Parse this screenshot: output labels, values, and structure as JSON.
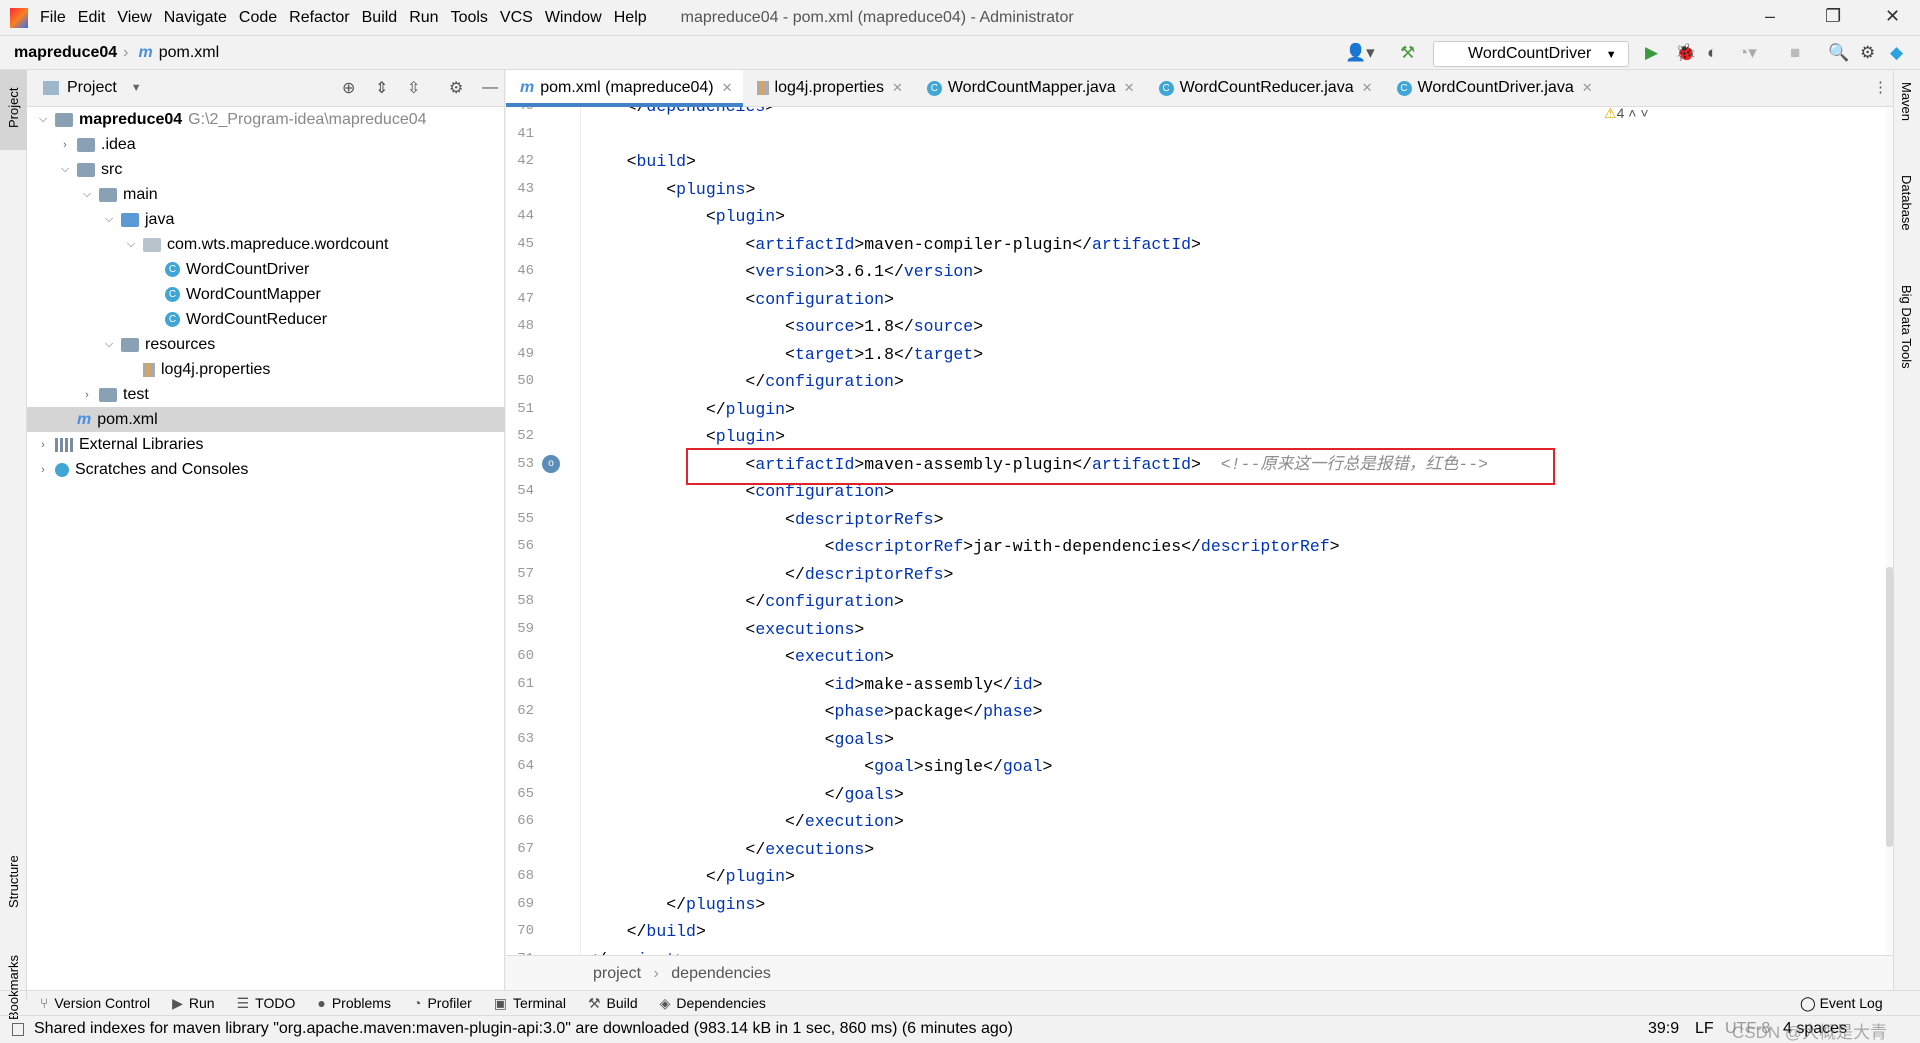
{
  "menu": [
    "File",
    "Edit",
    "View",
    "Navigate",
    "Code",
    "Refactor",
    "Build",
    "Run",
    "Tools",
    "VCS",
    "Window",
    "Help"
  ],
  "window_title": "mapreduce04 - pom.xml (mapreduce04) - Administrator",
  "nav": {
    "project": "mapreduce04",
    "file": "pom.xml",
    "run_config": "WordCountDriver"
  },
  "left_stripe": {
    "project": "Project",
    "structure": "Structure",
    "bookmarks": "Bookmarks"
  },
  "right_stripe": {
    "maven": "Maven",
    "database": "Database",
    "bigdata": "Big Data Tools"
  },
  "project_panel": {
    "title": "Project",
    "tree": [
      {
        "label": "mapreduce04",
        "extra": "G:\\2_Program-idea\\mapreduce04",
        "level": 0,
        "arrow": "v",
        "icon": "folder",
        "bold": true
      },
      {
        "label": ".idea",
        "level": 1,
        "arrow": ">",
        "icon": "folder"
      },
      {
        "label": "src",
        "level": 1,
        "arrow": "v",
        "icon": "folder"
      },
      {
        "label": "main",
        "level": 2,
        "arrow": "v",
        "icon": "folder"
      },
      {
        "label": "java",
        "level": 3,
        "arrow": "v",
        "icon": "folder"
      },
      {
        "label": "com.wts.mapreduce.wordcount",
        "level": 4,
        "arrow": "v",
        "icon": "package"
      },
      {
        "label": "WordCountDriver",
        "level": 5,
        "icon": "class"
      },
      {
        "label": "WordCountMapper",
        "level": 5,
        "icon": "class"
      },
      {
        "label": "WordCountReducer",
        "level": 5,
        "icon": "class"
      },
      {
        "label": "resources",
        "level": 3,
        "arrow": "v",
        "icon": "folder"
      },
      {
        "label": "log4j.properties",
        "level": 4,
        "icon": "properties"
      },
      {
        "label": "test",
        "level": 2,
        "arrow": ">",
        "icon": "folder"
      },
      {
        "label": "pom.xml",
        "level": 1,
        "icon": "maven",
        "selected": true
      },
      {
        "label": "External Libraries",
        "level": 0,
        "arrow": ">",
        "icon": "library"
      },
      {
        "label": "Scratches and Consoles",
        "level": 0,
        "arrow": ">",
        "icon": "scratch"
      }
    ]
  },
  "tabs": [
    {
      "label": "pom.xml (mapreduce04)",
      "icon": "maven",
      "active": true
    },
    {
      "label": "log4j.properties",
      "icon": "properties"
    },
    {
      "label": "WordCountMapper.java",
      "icon": "class"
    },
    {
      "label": "WordCountReducer.java",
      "icon": "class"
    },
    {
      "label": "WordCountDriver.java",
      "icon": "class"
    }
  ],
  "warnings": "4",
  "code_lines": [
    {
      "n": "40",
      "t": "    </dependencies>"
    },
    {
      "n": "41",
      "t": ""
    },
    {
      "n": "42",
      "t": "    <build>"
    },
    {
      "n": "43",
      "t": "        <plugins>"
    },
    {
      "n": "44",
      "t": "            <plugin>"
    },
    {
      "n": "45",
      "t": "                <artifactId>maven-compiler-plugin</artifactId>"
    },
    {
      "n": "46",
      "t": "                <version>3.6.1</version>"
    },
    {
      "n": "47",
      "t": "                <configuration>"
    },
    {
      "n": "48",
      "t": "                    <source>1.8</source>"
    },
    {
      "n": "49",
      "t": "                    <target>1.8</target>"
    },
    {
      "n": "50",
      "t": "                </configuration>"
    },
    {
      "n": "51",
      "t": "            </plugin>"
    },
    {
      "n": "52",
      "t": "            <plugin>"
    },
    {
      "n": "53",
      "t": "                <artifactId>maven-assembly-plugin</artifactId>  <!--原来这一行总是报错，红色-->"
    },
    {
      "n": "54",
      "t": "                <configuration>"
    },
    {
      "n": "55",
      "t": "                    <descriptorRefs>"
    },
    {
      "n": "56",
      "t": "                        <descriptorRef>jar-with-dependencies</descriptorRef>"
    },
    {
      "n": "57",
      "t": "                    </descriptorRefs>"
    },
    {
      "n": "58",
      "t": "                </configuration>"
    },
    {
      "n": "59",
      "t": "                <executions>"
    },
    {
      "n": "60",
      "t": "                    <execution>"
    },
    {
      "n": "61",
      "t": "                        <id>make-assembly</id>"
    },
    {
      "n": "62",
      "t": "                        <phase>package</phase>"
    },
    {
      "n": "63",
      "t": "                        <goals>"
    },
    {
      "n": "64",
      "t": "                            <goal>single</goal>"
    },
    {
      "n": "65",
      "t": "                        </goals>"
    },
    {
      "n": "66",
      "t": "                    </execution>"
    },
    {
      "n": "67",
      "t": "                </executions>"
    },
    {
      "n": "68",
      "t": "            </plugin>"
    },
    {
      "n": "69",
      "t": "        </plugins>"
    },
    {
      "n": "70",
      "t": "    </build>"
    },
    {
      "n": "71",
      "t": "</project>"
    }
  ],
  "breadcrumbs": [
    "project",
    "dependencies"
  ],
  "bottom_tools": [
    "Version Control",
    "Run",
    "TODO",
    "Problems",
    "Profiler",
    "Terminal",
    "Build",
    "Dependencies"
  ],
  "event_log": "Event Log",
  "status": {
    "message": "Shared indexes for maven library \"org.apache.maven:maven-plugin-api:3.0\" are downloaded (983.14 kB in 1 sec, 860 ms) (6 minutes ago)",
    "position": "39:9",
    "line_sep": "LF",
    "encoding": "UTF-8",
    "indent": "4 spaces",
    "watermark": "CSDN @大概是大青"
  },
  "colors": {
    "tag": "#0033b3",
    "comment": "#8c8c8c",
    "highlight_box": "#e0232b",
    "tab_underline": "#4083c9"
  }
}
